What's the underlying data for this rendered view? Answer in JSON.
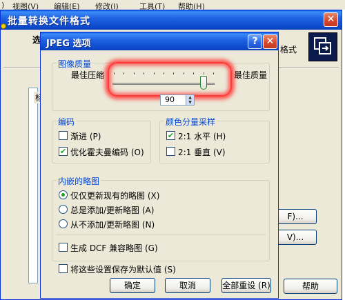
{
  "app_menu": {
    "items": [
      ")",
      "视图(V)",
      "编辑(E)",
      "修改(I)",
      "工具(T)",
      "帮助(H)"
    ]
  },
  "background_window": {
    "title": "批量转换文件格式",
    "close_glyph": "✕",
    "heading": "选",
    "heading_right": "格式",
    "group_label": "标",
    "buttons": {
      "btn1": "F)...",
      "btn2": "V)...",
      "help": "帮助"
    }
  },
  "dialog": {
    "title": "JPEG 选项",
    "help_glyph": "?",
    "close_glyph": "✕",
    "image_quality": {
      "label": "图像质量",
      "min_label": "最佳压缩",
      "max_label": "最佳质量",
      "value": 90,
      "value_text": "90",
      "min": 0,
      "max": 100
    },
    "encoding": {
      "label": "编码",
      "progressive": {
        "label": "渐进 (P)",
        "checked": false
      },
      "optimized_huffman": {
        "label": "优化霍夫曼编码 (O)",
        "checked": true
      }
    },
    "chroma": {
      "label": "颜色分量采样",
      "h_2_1": {
        "label": "2:1 水平 (H)",
        "checked": true
      },
      "v_2_1": {
        "label": "2:1 垂直 (V)",
        "checked": false
      }
    },
    "thumbnail": {
      "label": "内嵌的略图",
      "update_existing": {
        "label": "仅仅更新现有的略图 (X)",
        "selected": true
      },
      "always_add": {
        "label": "总是添加/更新略图 (A)",
        "selected": false
      },
      "never_add": {
        "label": "从不添加/更新略图 (N)",
        "selected": false
      },
      "dcf_compatible": {
        "label": "生成 DCF 兼容略图 (G)",
        "checked": false
      }
    },
    "save_defaults": {
      "label": "将这些设置保存为默认值 (S)",
      "checked": false
    },
    "buttons": {
      "ok": "确定",
      "cancel": "取消",
      "reset_all": "全部重设 (R)"
    }
  },
  "colors": {
    "titlebar": "#0b47c9",
    "window_bg": "#ece9d8",
    "group_label": "#0046d5",
    "check": "#21a121",
    "highlight": "#ff3c3c"
  }
}
